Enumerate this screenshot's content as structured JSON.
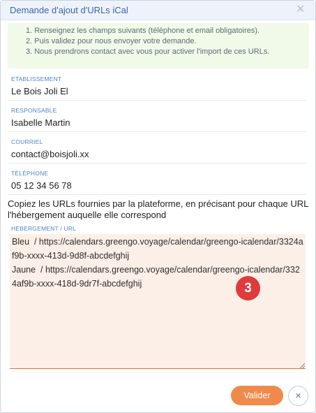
{
  "dialog": {
    "title": "Demande d'ajout d'URLs iCal",
    "close_icon": "close-icon"
  },
  "info": {
    "steps": [
      "1. Renseignez les champs suivants (téléphone et email obligatoires).",
      "2. Puis validez pour nous envoyer votre demande.",
      "3. Nous prendrons contact avec vous pour activer l'import de ces URLs."
    ]
  },
  "fields": {
    "etablissement": {
      "label": "ETABLISSEMENT",
      "value": "Le Bois Joli El"
    },
    "responsable": {
      "label": "RESPONSABLE",
      "value": "Isabelle Martin"
    },
    "courriel": {
      "label": "COURRIEL",
      "value": "contact@boisjoli.xx"
    },
    "telephone": {
      "label": "TÉLÉPHONE",
      "value": "05 12 34 56 78"
    }
  },
  "instruction": "Copiez les URLs fournies par la plateforme, en précisant pour chaque URL l'hébergement auquelle elle correspond",
  "urls": {
    "label": "HÉBERGEMENT / URL",
    "value": "Bleu  / https://calendars.greengo.voyage/calendar/greengo-icalendar/3324af9b-xxxx-413d-9d8f-abcdefghij\nJaune  / https://calendars.greengo.voyage/calendar/greengo-icalendar/3324af9b-xxxx-418d-9dr7f-abcdefghij"
  },
  "annotation_badge": "3",
  "buttons": {
    "submit_label": "Valider",
    "close_glyph": "×"
  },
  "colors": {
    "title": "#3c64a8",
    "label": "#4b86c5",
    "info_bg": "#f1f9e8",
    "textarea_bg": "#fcefe8",
    "accent": "#f08a4b",
    "badge": "#e03a3a"
  }
}
